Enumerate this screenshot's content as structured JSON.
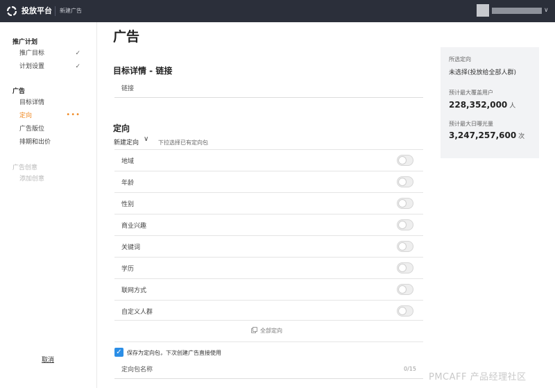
{
  "header": {
    "brand": "投放平台",
    "breadcrumb": "新建广告",
    "user_caret": "∨"
  },
  "sidebar": {
    "group_plan": "推广计划",
    "plan_items": [
      {
        "label": "推广目标",
        "check": "✓"
      },
      {
        "label": "计划设置",
        "check": "✓"
      }
    ],
    "group_ad": "广告",
    "ad_items": [
      {
        "label": "目标详情"
      },
      {
        "label": "定向",
        "dots": "•••"
      },
      {
        "label": "广告版位"
      },
      {
        "label": "排期和出价"
      }
    ],
    "group_creative": "广告创意",
    "creative_items": [
      {
        "label": "添加创意"
      }
    ],
    "cancel": "取消"
  },
  "main": {
    "page_title": "广告",
    "goal_section_title": "目标详情 - 链接",
    "link_placeholder": "链接",
    "targeting_title": "定向",
    "new_target": "新建定向",
    "new_target_caret": "∨",
    "target_hint": "下拉选择已有定向包",
    "targeting_rows": [
      {
        "label": "地域",
        "on": false
      },
      {
        "label": "年龄",
        "on": false
      },
      {
        "label": "性别",
        "on": false
      },
      {
        "label": "商业兴趣",
        "on": false
      },
      {
        "label": "关键词",
        "on": false
      },
      {
        "label": "学历",
        "on": false
      },
      {
        "label": "联网方式",
        "on": false
      },
      {
        "label": "自定义人群",
        "on": false
      }
    ],
    "all_targets": "全部定向",
    "save_checkbox_checked": true,
    "save_label": "保存为定向包，下次创建广告直接使用",
    "package_name_placeholder": "定向包名称",
    "package_name_count": "0/15"
  },
  "summary": {
    "selected_label": "所选定向",
    "selected_value": "未选择(投放给全部人群)",
    "coverage_label": "预计最大覆盖用户",
    "coverage_value": "228,352,000",
    "coverage_unit": "人",
    "exposure_label": "预计最大日曝光量",
    "exposure_value": "3,247,257,600",
    "exposure_unit": "次"
  },
  "watermark": "PMCAFF 产品经理社区",
  "colors": {
    "topbar": "#2b2f3a",
    "accent": "#f08a24",
    "checkbox": "#2b8ee6"
  }
}
